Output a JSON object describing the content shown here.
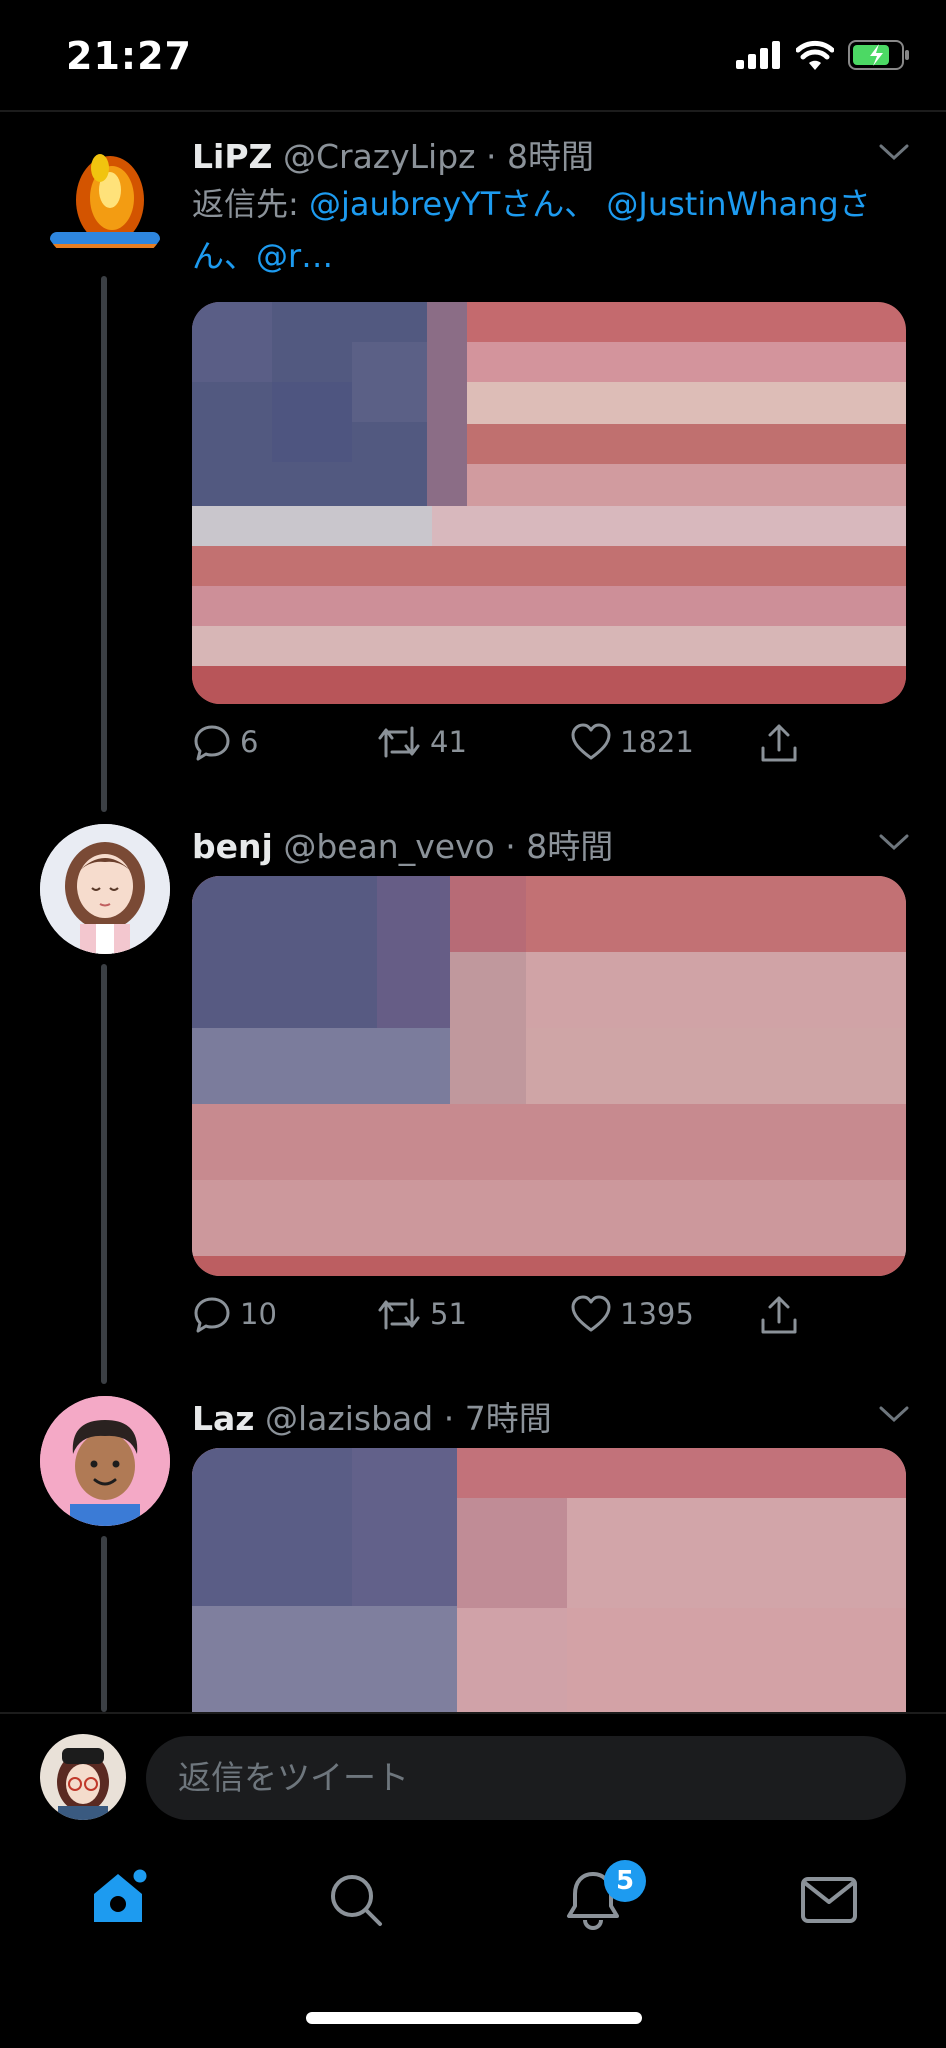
{
  "status_bar": {
    "time": "21:27"
  },
  "tweets": [
    {
      "name": "LiPZ",
      "handle": "@CrazyLipz",
      "time": "· 8時間",
      "reply_prefix": "返信先: ",
      "reply_mentions": "@jaubreyYTさん、 @JustinWhangさん、@r…",
      "replies": "6",
      "retweets": "41",
      "likes": "1821"
    },
    {
      "name": "benj",
      "handle": "@bean_vevo",
      "time": "· 8時間",
      "replies": "10",
      "retweets": "51",
      "likes": "1395"
    },
    {
      "name": "Laz",
      "handle": "@lazisbad",
      "time": "· 7時間"
    }
  ],
  "composer": {
    "placeholder": "返信をツイート"
  },
  "tab_bar": {
    "notifications_badge": "5"
  },
  "colors": {
    "accent": "#1d9bf0",
    "background": "#000000",
    "muted": "#8b9299"
  },
  "icons": [
    "home-icon",
    "search-icon",
    "notifications-icon",
    "messages-icon",
    "reply-icon",
    "retweet-icon",
    "like-icon",
    "share-icon",
    "chevron-down-icon",
    "signal-icon",
    "wifi-icon",
    "battery-icon"
  ]
}
